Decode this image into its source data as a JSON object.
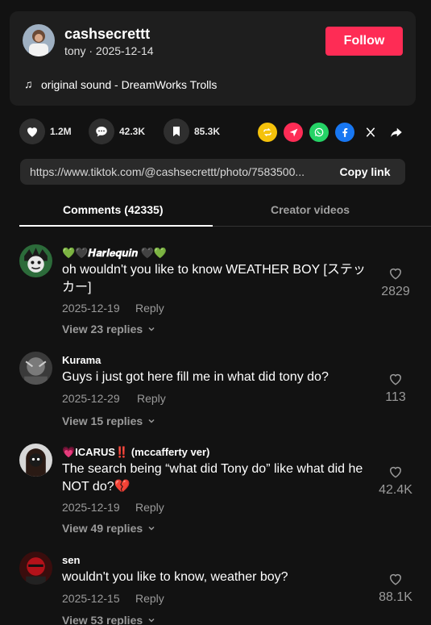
{
  "creator": {
    "username": "cashsecrettt",
    "meta": "tony · 2025-12-14",
    "follow_label": "Follow",
    "music": "original sound - DreamWorks Trolls"
  },
  "actions": {
    "likes": "1.2M",
    "comments": "42.3K",
    "saves": "85.3K"
  },
  "share_icons": [
    "repost-icon",
    "send-icon",
    "whatsapp-icon",
    "facebook-icon",
    "x-icon",
    "share-arrow-icon"
  ],
  "link": {
    "url": "https://www.tiktok.com/@cashsecrettt/photo/7583500...",
    "copy_label": "Copy link"
  },
  "tabs": {
    "comments": "Comments (42335)",
    "videos": "Creator videos"
  },
  "comments": [
    {
      "user": "💚🖤𝑯𝒂𝒓𝒍𝒆𝒒𝒖𝒊𝒏 🖤💚",
      "text": "oh wouldn't you like to know WEATHER BOY [ステッカー]",
      "date": "2025-12-19",
      "reply": "Reply",
      "view_replies": "View 23 replies",
      "likes": "2829"
    },
    {
      "user": "Kurama",
      "text": "Guys i just got here fill me in what did tony do?",
      "date": "2025-12-29",
      "reply": "Reply",
      "view_replies": "View 15 replies",
      "likes": "113"
    },
    {
      "user": "💗ICARUS‼️ (mccafferty ver)",
      "text": "The search being “what did Tony do” like what did he NOT do?💔",
      "date": "2025-12-19",
      "reply": "Reply",
      "view_replies": "View 49 replies",
      "likes": "42.4K"
    },
    {
      "user": "sen",
      "text": "wouldn't you like to know, weather boy?",
      "date": "2025-12-15",
      "reply": "Reply",
      "view_replies": "View 53 replies",
      "likes": "88.1K"
    }
  ]
}
